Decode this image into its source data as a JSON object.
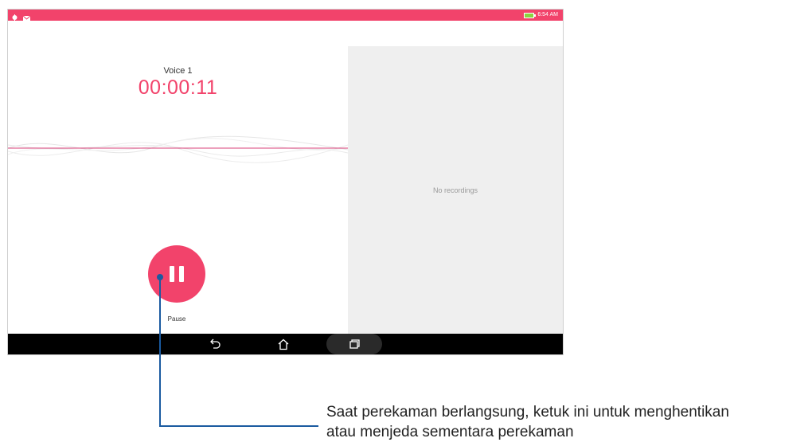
{
  "status_bar": {
    "left_icons": [
      "notification-icon",
      "mail-icon"
    ],
    "time": "6:54 AM",
    "accent": "#f2436b"
  },
  "recorder": {
    "recording_name": "Voice 1",
    "elapsed_time": "00:00:11",
    "pause_label": "Pause"
  },
  "recordings_list": {
    "empty_text": "No recordings"
  },
  "nav_bar": {
    "buttons": [
      "back-icon",
      "home-icon",
      "recent-apps-icon"
    ]
  },
  "callout": {
    "line1": "Saat perekaman berlangsung, ketuk ini untuk menghentikan",
    "line2": "atau menjeda sementara perekaman"
  }
}
